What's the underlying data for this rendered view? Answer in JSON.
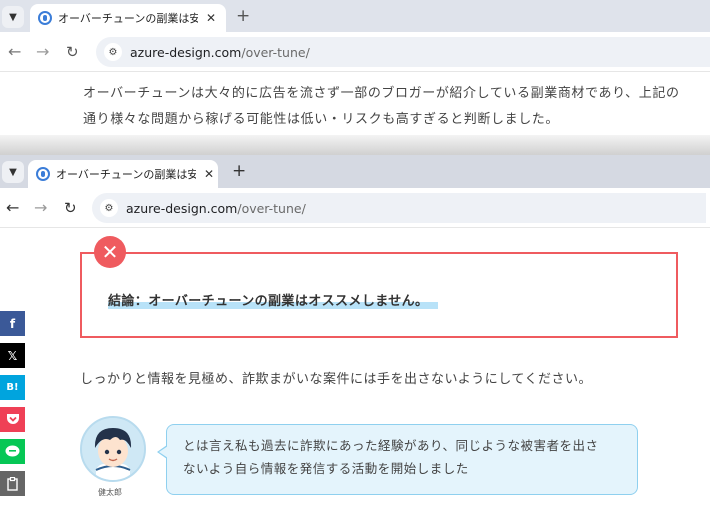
{
  "window1": {
    "tab": {
      "title": "オーバーチューンの副業は安全？口コ"
    },
    "address": {
      "domain": "azure-design.com",
      "path": "/over-tune/"
    },
    "paragraph": {
      "line1": "オーバーチューンは大々的に広告を流さず一部のブロガーが紹介している副業商材であり、上記の",
      "line2": "通り様々な問題から稼げる可能性は低い・リスクも高すぎると判断しました。"
    }
  },
  "window2": {
    "tab": {
      "title": "オーバーチューンの副業は安全？口コ"
    },
    "address": {
      "domain": "azure-design.com",
      "path": "/over-tune/"
    },
    "share_buttons": [
      {
        "label": "f",
        "icon": "facebook-icon"
      },
      {
        "label": "𝕏",
        "icon": "x-icon"
      },
      {
        "label": "B!",
        "icon": "hatena-bookmark-icon"
      },
      {
        "label": "",
        "icon": "pocket-icon"
      },
      {
        "label": "",
        "icon": "line-icon"
      },
      {
        "label": "",
        "icon": "copy-icon"
      }
    ],
    "conclusion": "結論：オーバーチューンの副業はオススメしません。",
    "paragraph": "しっかりと情報を見極め、詐欺まがいな案件には手を出さないようにしてください。",
    "speech": {
      "name": "健太郎",
      "line1": "とは言え私も過去に詐欺にあった経験があり、同じような被害者を出さ",
      "line2": "ないよう自ら情報を発信する活動を開始しました"
    }
  },
  "colors": {
    "conclusion_border": "#ef5b5f",
    "highlight": "#b8e2f8",
    "bubble_bg": "#e4f4fc",
    "bubble_border": "#8fd0ef"
  }
}
